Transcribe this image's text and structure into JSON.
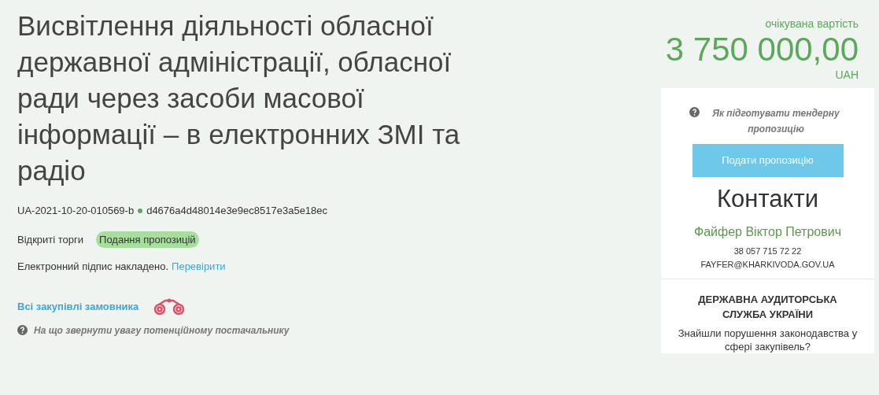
{
  "title": "Висвітлення діяльності обласної державної адміністрації, обласної ради через засоби масової інформації – в електронних ЗМІ та радіо",
  "tender_id": "UA-2021-10-20-010569-b",
  "hash": "d4676a4d48014e3e9ec8517e3a5e18ec",
  "procedure_type": "Відкриті торги",
  "status": {
    "label": "Подання пропозицій",
    "color": "#a6de9b"
  },
  "signature": {
    "text": "Електронний підпис накладено.",
    "link": "Перевірити"
  },
  "buyer_link": "Всі закупівлі замовника",
  "hint": "На що звернути увагу потенційному постачальнику",
  "price": {
    "label": "очікувана вартість",
    "amount": "3 750 000,00",
    "currency": "UAH"
  },
  "panel": {
    "help": "Як підготувати тендерну пропозицію",
    "button": "Подати пропозицію",
    "contacts_title": "Контакти",
    "contact_name": "Файфер Віктор Петрович",
    "phone": "38 057 715 72 22",
    "email": "FAYFER@KHARKIVODA.GOV.UA"
  },
  "audit": {
    "title": "ДЕРЖАВНА АУДИТОРСЬКА СЛУЖБА УКРАЇНИ",
    "text": "Знайшли порушення законодавства у сфері закупівель?"
  }
}
